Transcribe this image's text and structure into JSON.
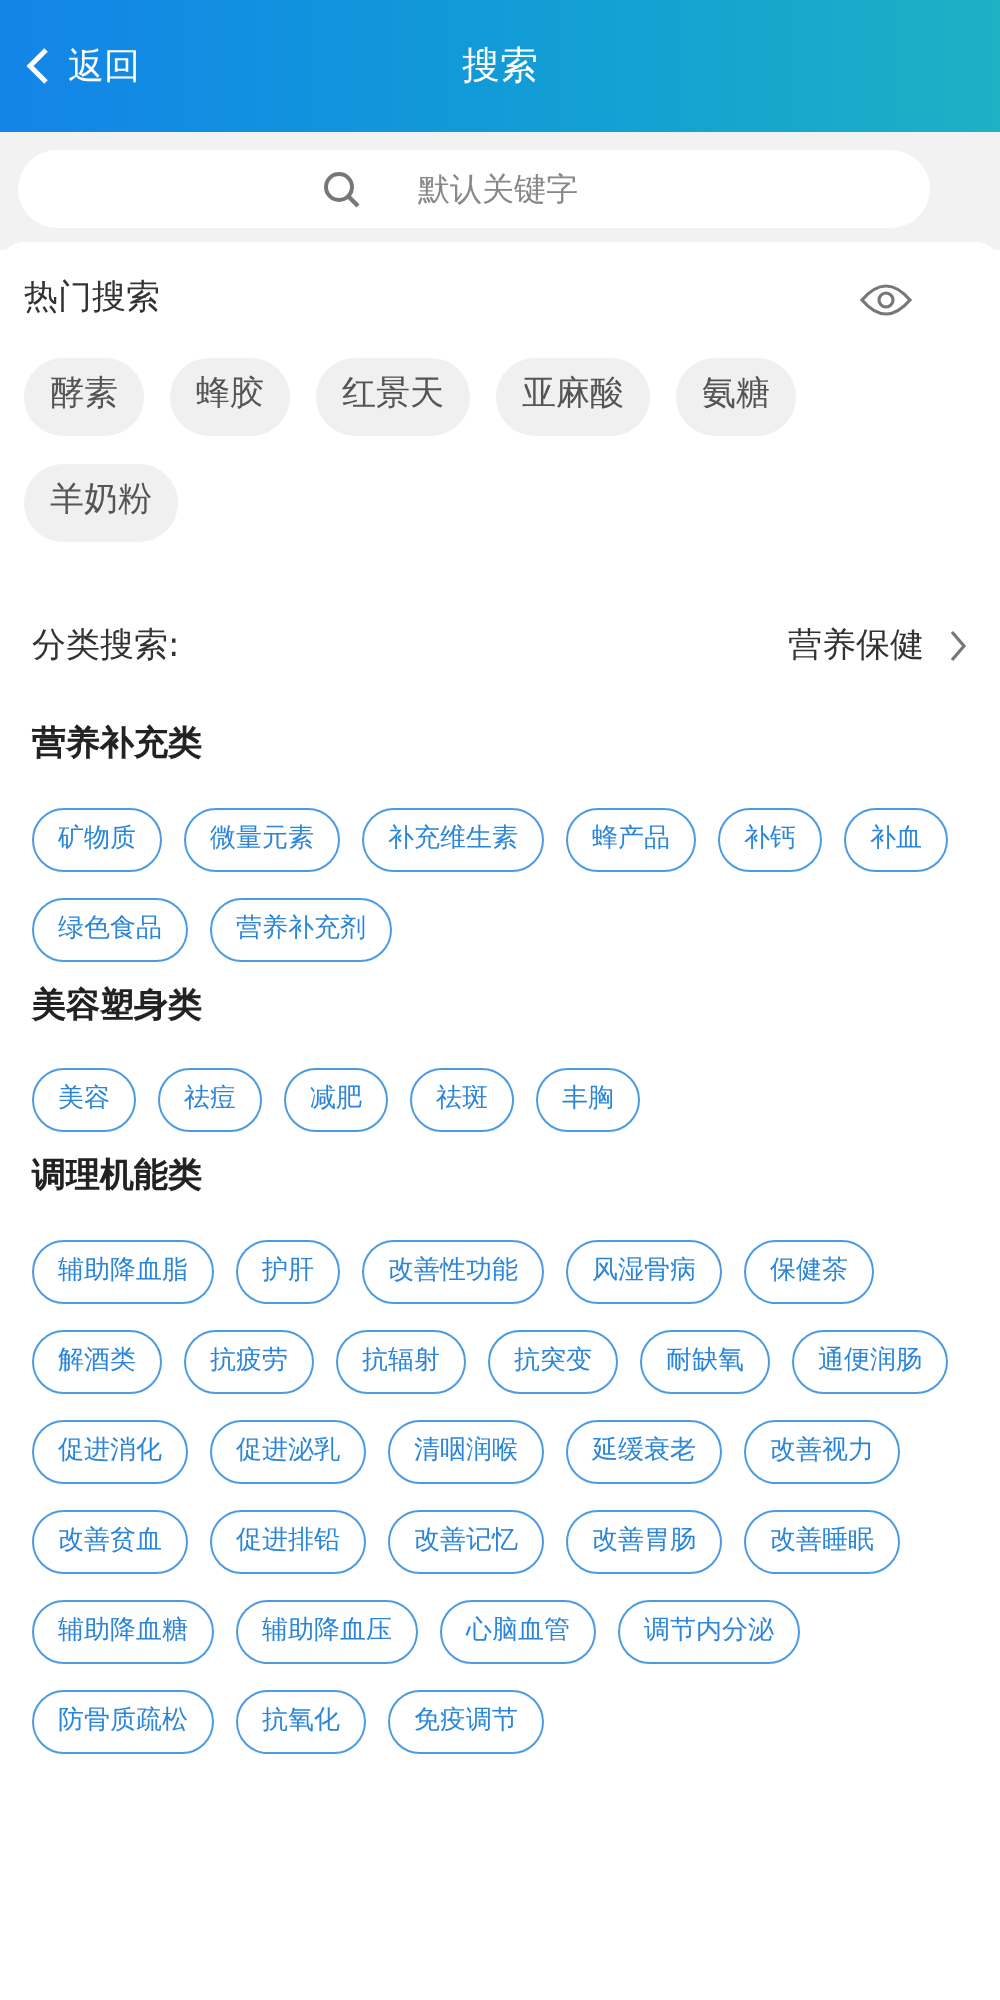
{
  "header": {
    "back_label": "返回",
    "title": "搜索"
  },
  "search": {
    "placeholder": "默认关键字"
  },
  "hot_search": {
    "title": "热门搜索",
    "tags": [
      "酵素",
      "蜂胶",
      "红景天",
      "亚麻酸",
      "氨糖",
      "羊奶粉"
    ]
  },
  "category_search": {
    "label": "分类搜索:",
    "value": "营养保健"
  },
  "groups": [
    {
      "title": "营养补充类",
      "tags": [
        "矿物质",
        "微量元素",
        "补充维生素",
        "蜂产品",
        "补钙",
        "补血",
        "绿色食品",
        "营养补充剂"
      ]
    },
    {
      "title": "美容塑身类",
      "tags": [
        "美容",
        "祛痘",
        "减肥",
        "祛斑",
        "丰胸"
      ]
    },
    {
      "title": "调理机能类",
      "tags": [
        "辅助降血脂",
        "护肝",
        "改善性功能",
        "风湿骨病",
        "保健茶",
        "解酒类",
        "抗疲劳",
        "抗辐射",
        "抗突变",
        "耐缺氧",
        "通便润肠",
        "促进消化",
        "促进泌乳",
        "清咽润喉",
        "延缓衰老",
        "改善视力",
        "改善贫血",
        "促进排铅",
        "改善记忆",
        "改善胃肠",
        "改善睡眠",
        "辅助降血糖",
        "辅助降血压",
        "心脑血管",
        "调节内分泌",
        "防骨质疏松",
        "抗氧化",
        "免疫调节"
      ]
    }
  ]
}
